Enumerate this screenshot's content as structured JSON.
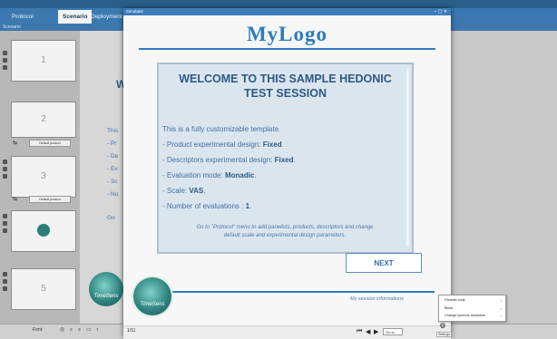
{
  "app": {
    "tabs": [
      "Protocol",
      "Scenario",
      "Deployment"
    ],
    "scenario_pane_title": "Scenario",
    "slides": [
      "1",
      "2",
      "3",
      "",
      "5"
    ],
    "design_label": "Default product",
    "bg_main_letter": "W",
    "bg_main_lines": [
      "This",
      "- Pr",
      "- De",
      "- Ev",
      "- Sc",
      "- Nu",
      "Go"
    ],
    "status_left": "Font:"
  },
  "simulator": {
    "title": "Simulator",
    "close": "– ▢ ✕",
    "logo": "MyLogo",
    "welcome": {
      "title_line1": "WELCOME TO THIS SAMPLE HEDONIC",
      "title_line2": "TEST SESSION",
      "intro": "This is a fully customizable template.",
      "items": [
        {
          "label": "- Product experimental design: ",
          "value": "Fixed",
          "end": "."
        },
        {
          "label": "- Descriptors experimental design: ",
          "value": "Fixed",
          "end": "."
        },
        {
          "label": "- Evaluation mode: ",
          "value": "Monadic",
          "end": "."
        },
        {
          "label": "- Scale: ",
          "value": "VAS",
          "end": "."
        },
        {
          "label": "- Number of evaluations : ",
          "value": "1",
          "end": "."
        }
      ],
      "hint_line1": "Go to \"Protocol\" menu to add panelists, products, descriptors and change",
      "hint_line2": "default scale and experimental design parameters."
    },
    "next_button": "NEXT",
    "session_info": "My session informations",
    "brand_logo_text": "TimeSens",
    "page_counter": "1/11",
    "goto_label": "Go to..."
  },
  "context_menu": {
    "items": [
      "Panelist code",
      "Block",
      "Change screens resolution"
    ]
  },
  "settings_label": "Settings",
  "colors": {
    "accent": "#2f7bbf",
    "box_bg": "#dbe5ee",
    "titlebar": "#3c7dbb"
  }
}
